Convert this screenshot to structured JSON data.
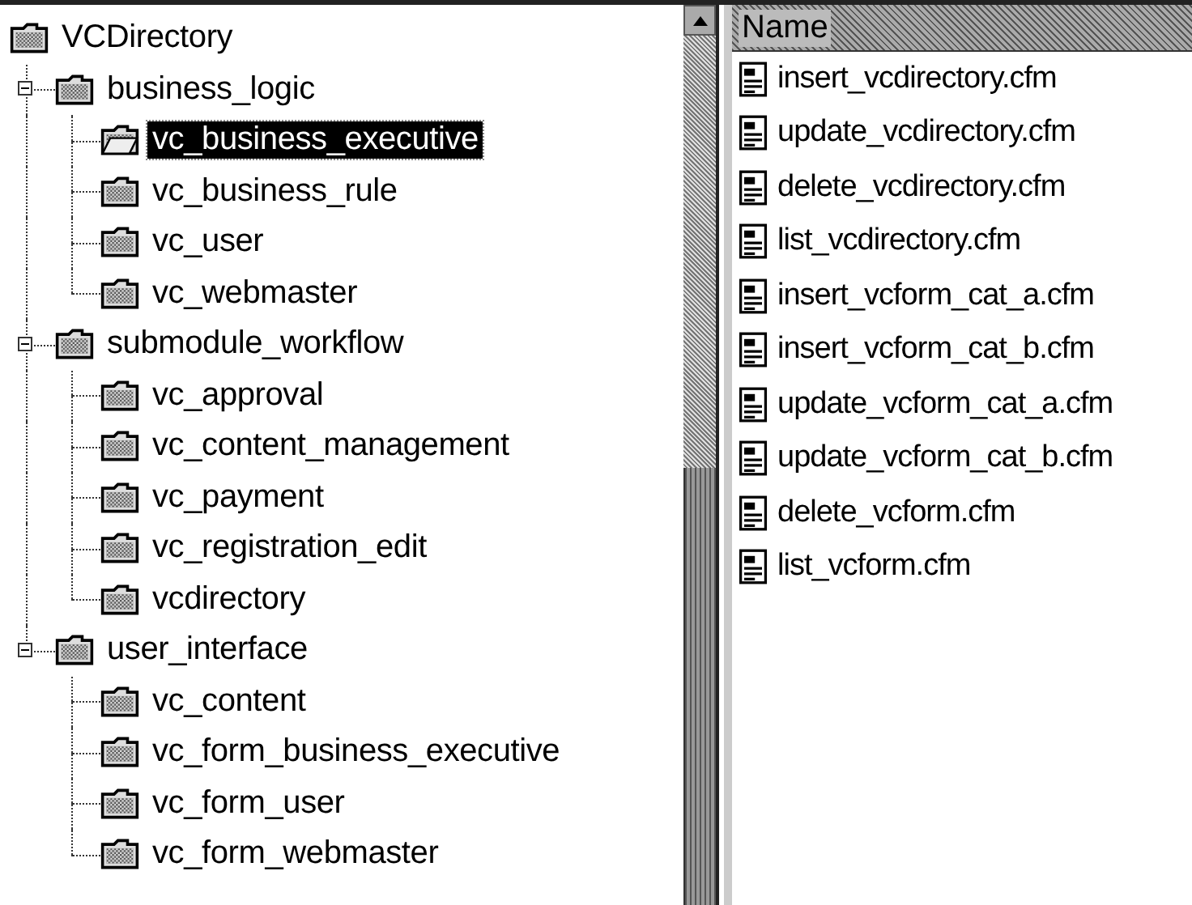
{
  "tree": {
    "label": "VCDirectory",
    "selected": false,
    "children": [
      {
        "label": "business_logic",
        "expanded": true,
        "selected": false,
        "children": [
          {
            "label": "vc_business_executive",
            "selected": true
          },
          {
            "label": "vc_business_rule",
            "selected": false
          },
          {
            "label": "vc_user",
            "selected": false
          },
          {
            "label": "vc_webmaster",
            "selected": false
          }
        ]
      },
      {
        "label": "submodule_workflow",
        "expanded": true,
        "selected": false,
        "children": [
          {
            "label": "vc_approval",
            "selected": false
          },
          {
            "label": "vc_content_management",
            "selected": false
          },
          {
            "label": "vc_payment",
            "selected": false
          },
          {
            "label": "vc_registration_edit",
            "selected": false
          },
          {
            "label": "vcdirectory",
            "selected": false
          }
        ]
      },
      {
        "label": "user_interface",
        "expanded": true,
        "selected": false,
        "children": [
          {
            "label": "vc_content",
            "selected": false
          },
          {
            "label": "vc_form_business_executive",
            "selected": false
          },
          {
            "label": "vc_form_user",
            "selected": false
          },
          {
            "label": "vc_form_webmaster",
            "selected": false
          }
        ]
      }
    ]
  },
  "file_list": {
    "column": "Name",
    "files": [
      "insert_vcdirectory.cfm",
      "update_vcdirectory.cfm",
      "delete_vcdirectory.cfm",
      "list_vcdirectory.cfm",
      "insert_vcform_cat_a.cfm",
      "insert_vcform_cat_b.cfm",
      "update_vcform_cat_a.cfm",
      "update_vcform_cat_b.cfm",
      "delete_vcform.cfm",
      "list_vcform.cfm"
    ]
  }
}
